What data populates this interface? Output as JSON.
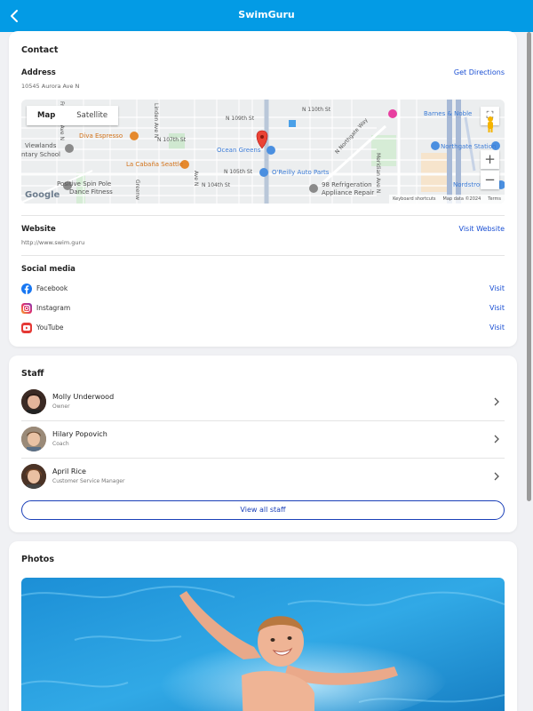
{
  "app": {
    "title": "SwimGuru"
  },
  "contact": {
    "title": "Contact",
    "address_label": "Address",
    "address": "10545 Aurora Ave N",
    "directions_link": "Get Directions",
    "website_label": "Website",
    "website_url": "http://www.swim.guru",
    "visit_website_link": "Visit Website",
    "social_label": "Social media",
    "social": [
      {
        "name": "Facebook",
        "icon": "facebook-icon",
        "link": "Visit"
      },
      {
        "name": "Instagram",
        "icon": "instagram-icon",
        "link": "Visit"
      },
      {
        "name": "YouTube",
        "icon": "youtube-icon",
        "link": "Visit"
      }
    ]
  },
  "map": {
    "map_tab": "Map",
    "satellite_tab": "Satellite",
    "zoom_in": "+",
    "zoom_out": "−",
    "places": {
      "diva": "Diva Espresso",
      "cabana": "La Cabaña Seattle",
      "ocean": "Ocean Greens",
      "oreilly": "O'Reilly Auto Parts",
      "positive1": "Positive Spin Pole",
      "positive2": "Dance Fitness",
      "viewlands1": "Viewlands",
      "viewlands2": "ntary School",
      "refrig1": "98 Refrigeration",
      "refrig2": "Appliance Repair",
      "barnes": "Barnes & Noble",
      "northgate": "Northgate Station",
      "nordstrom": "Nordstrom"
    },
    "streets": {
      "n109": "N 109th St",
      "n110": "N 110th St",
      "n107": "N 107th St",
      "n105": "N 105th St",
      "n104": "N 104th St",
      "northgate_way": "N Northgate Way",
      "meridian": "Meridian Ave N",
      "linden": "Linden Ave N",
      "greenwood": "Greenw",
      "fremont": "Fremont Ave N",
      "ave_n": "Ave N"
    },
    "footer": {
      "shortcuts": "Keyboard shortcuts",
      "mapdata": "Map data ©2024",
      "terms": "Terms"
    },
    "google": "Google"
  },
  "staff": {
    "title": "Staff",
    "members": [
      {
        "name": "Molly Underwood",
        "role": "Owner"
      },
      {
        "name": "Hilary Popovich",
        "role": "Coach"
      },
      {
        "name": "April Rice",
        "role": "Customer Service Manager"
      }
    ],
    "view_all": "View all staff"
  },
  "photos": {
    "title": "Photos"
  },
  "colors": {
    "header": "#039be5",
    "link": "#1a4fd3",
    "button_border": "#1a3fb8"
  }
}
